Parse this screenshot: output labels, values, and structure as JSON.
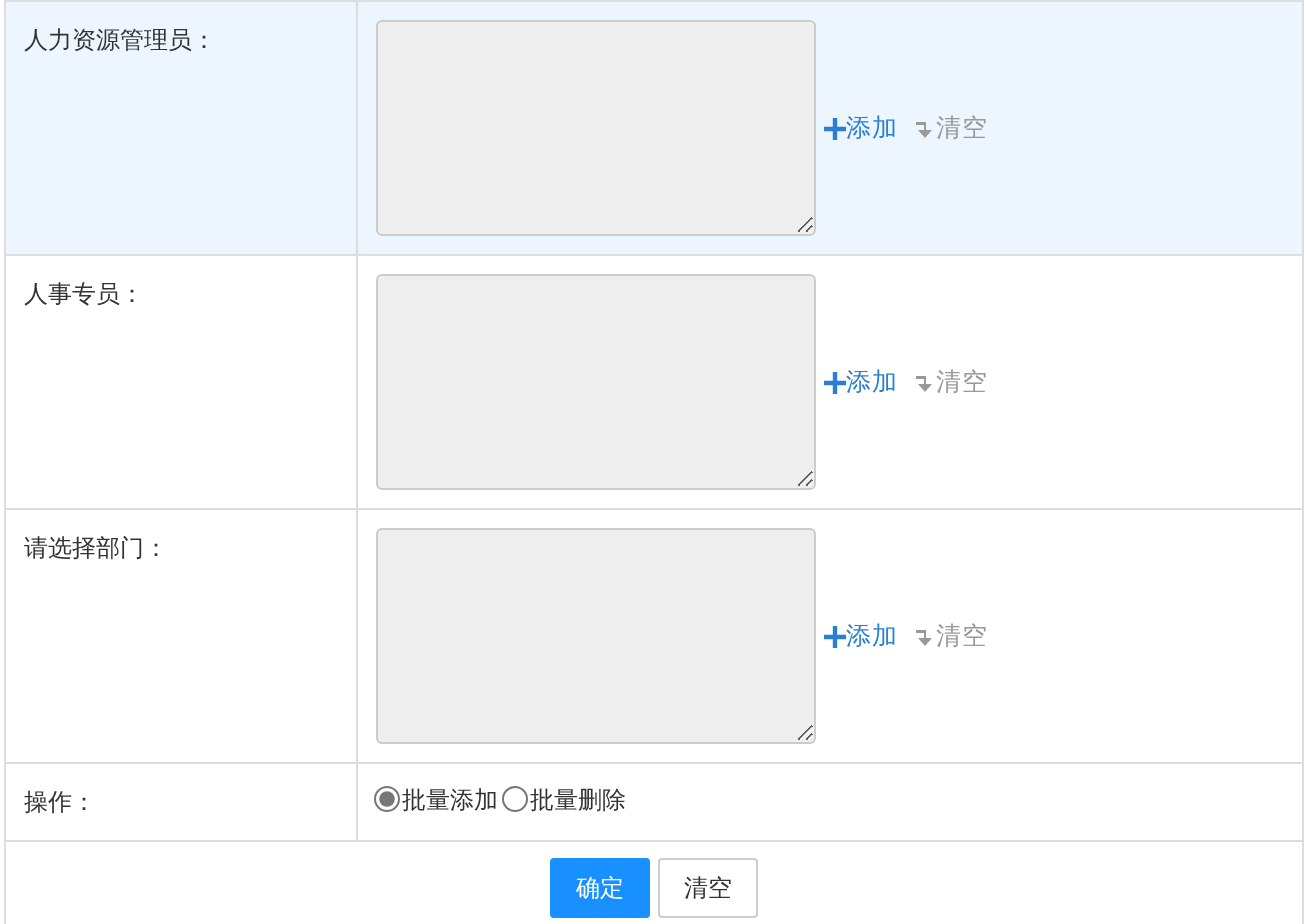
{
  "rows": [
    {
      "label": "人力资源管理员：",
      "highlighted": true,
      "add_link": "添加",
      "clear_link": "清空"
    },
    {
      "label": "人事专员：",
      "highlighted": false,
      "add_link": "添加",
      "clear_link": "清空"
    },
    {
      "label": "请选择部门：",
      "highlighted": false,
      "add_link": "添加",
      "clear_link": "清空"
    }
  ],
  "operation": {
    "label": "操作：",
    "options": [
      {
        "label": "批量添加",
        "selected": true
      },
      {
        "label": "批量删除",
        "selected": false
      }
    ]
  },
  "buttons": [
    {
      "label": "确定",
      "kind": "primary"
    },
    {
      "label": "清空",
      "kind": "default"
    }
  ]
}
